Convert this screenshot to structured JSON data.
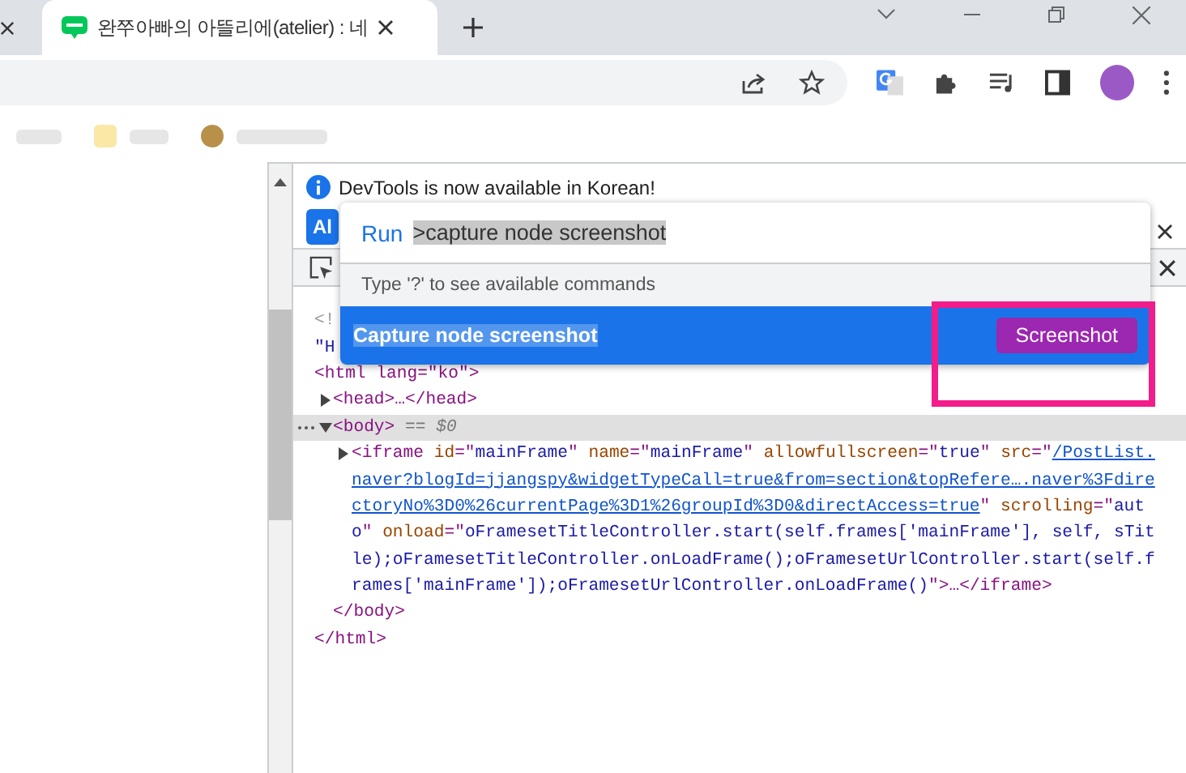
{
  "tabs": [
    {
      "title": "완쭈아빠의 아뜰리에(atelier) : 네",
      "selected": true
    }
  ],
  "devtools": {
    "info_bar": {
      "message": "DevTools is now available in Korean!",
      "button": "Al"
    },
    "command_palette": {
      "prefix": "Run",
      "query": ">capture node screenshot",
      "hint": "Type '?' to see available commands",
      "items": [
        {
          "title": "Capture node screenshot",
          "badge": "Screenshot",
          "selected": true
        }
      ]
    },
    "dom_tree": [
      {
        "lines": [
          [
            {
              "kind": "doctype",
              "text": "<!"
            }
          ]
        ]
      },
      {
        "lines": [
          [
            {
              "kind": "value",
              "text": "\"H"
            }
          ]
        ]
      },
      {
        "lines": [
          [
            {
              "kind": "tag",
              "text": "<html lang=\"ko\">"
            }
          ]
        ],
        "closing": "</html>",
        "children": [
          {
            "expanded": false,
            "selected": false,
            "lines": [
              [
                {
                  "kind": "tag",
                  "text": "<head>…</head>"
                }
              ]
            ]
          },
          {
            "expanded": true,
            "selected": true,
            "lines": [
              [
                {
                  "kind": "tag",
                  "text": "<body>"
                },
                {
                  "kind": "note",
                  "text": " == $0"
                }
              ]
            ],
            "closing": "</body>",
            "children": [
              {
                "expanded": false,
                "selected": false,
                "lines": [
                  [
                    {
                      "kind": "tag",
                      "text": "<iframe "
                    },
                    {
                      "kind": "attr",
                      "text": "id"
                    },
                    {
                      "kind": "tag",
                      "text": "=\""
                    },
                    {
                      "kind": "value",
                      "text": "mainFrame"
                    },
                    {
                      "kind": "tag",
                      "text": "\" "
                    },
                    {
                      "kind": "attr",
                      "text": "name"
                    },
                    {
                      "kind": "tag",
                      "text": "=\""
                    },
                    {
                      "kind": "value",
                      "text": "mainFrame"
                    },
                    {
                      "kind": "tag",
                      "text": "\" "
                    },
                    {
                      "kind": "attr",
                      "text": "allowfullscreen"
                    },
                    {
                      "kind": "tag",
                      "text": "=\""
                    },
                    {
                      "kind": "value",
                      "text": "true"
                    },
                    {
                      "kind": "tag",
                      "text": "\" "
                    },
                    {
                      "kind": "attr",
                      "text": "src"
                    },
                    {
                      "kind": "tag",
                      "text": "=\""
                    },
                    {
                      "kind": "link",
                      "text": "/PostList."
                    }
                  ],
                  [
                    {
                      "kind": "link",
                      "text": "naver?blogId=jjangspy&widgetTypeCall=true&from=section&topRefere….naver%3Fdire"
                    }
                  ],
                  [
                    {
                      "kind": "link",
                      "text": "ctoryNo%3D0%26currentPage%3D1%26groupId%3D0&directAccess=true"
                    },
                    {
                      "kind": "tag",
                      "text": "\" "
                    },
                    {
                      "kind": "attr",
                      "text": "scrolling"
                    },
                    {
                      "kind": "tag",
                      "text": "=\""
                    },
                    {
                      "kind": "value",
                      "text": "aut"
                    }
                  ],
                  [
                    {
                      "kind": "value",
                      "text": "o"
                    },
                    {
                      "kind": "tag",
                      "text": "\" "
                    },
                    {
                      "kind": "attr",
                      "text": "onload"
                    },
                    {
                      "kind": "tag",
                      "text": "=\""
                    },
                    {
                      "kind": "value",
                      "text": "oFramesetTitleController.start(self.frames['mainFrame'], self, sTit"
                    }
                  ],
                  [
                    {
                      "kind": "value",
                      "text": "le);oFramesetTitleController.onLoadFrame();oFramesetUrlController.start(self.f"
                    }
                  ],
                  [
                    {
                      "kind": "value",
                      "text": "rames['mainFrame']);oFramesetUrlController.onLoadFrame()"
                    },
                    {
                      "kind": "tag",
                      "text": "\">…</iframe>"
                    }
                  ]
                ]
              }
            ]
          }
        ]
      }
    ]
  }
}
